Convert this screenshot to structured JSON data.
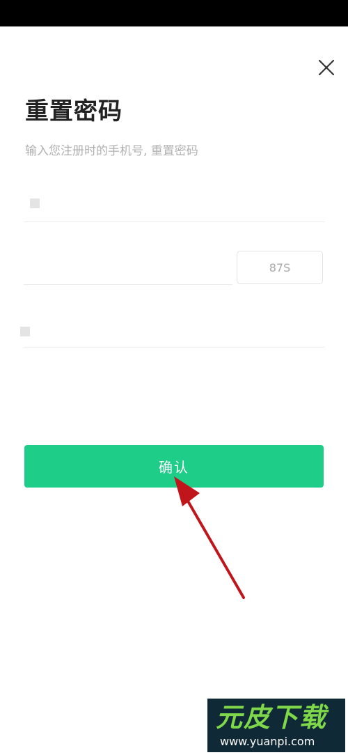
{
  "header": {
    "close_icon": "close-icon"
  },
  "page": {
    "title": "重置密码",
    "subtitle": "输入您注册时的手机号, 重置密码"
  },
  "form": {
    "phone_placeholder": "",
    "code_placeholder": "",
    "password_placeholder": "",
    "countdown_label": "87S"
  },
  "actions": {
    "confirm_label": "确认"
  },
  "watermark": {
    "brand": "元皮下载",
    "url": "www.yuanpi.com"
  },
  "colors": {
    "accent": "#1dcd88",
    "annotation_arrow": "#c0151a",
    "watermark_bg": "#0f2a36",
    "watermark_brand": "#7fd84a"
  }
}
